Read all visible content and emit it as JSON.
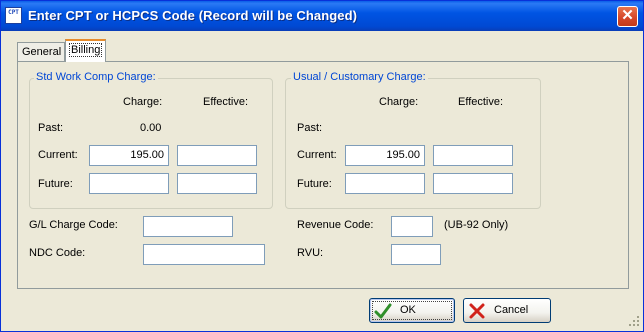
{
  "window": {
    "title": "Enter CPT or HCPCS Code  (Record will be Changed)",
    "icon_text": "CPT"
  },
  "tabs": [
    {
      "label": "General",
      "active": false
    },
    {
      "label": "Billing",
      "active": true
    }
  ],
  "std_group": {
    "title": "Std Work Comp Charge:",
    "col_charge": "Charge:",
    "col_effective": "Effective:",
    "past_label": "Past:",
    "past_value": "0.00",
    "current_label": "Current:",
    "current_charge": "195.00",
    "current_effective": "",
    "future_label": "Future:",
    "future_charge": "",
    "future_effective": ""
  },
  "usual_group": {
    "title": "Usual / Customary Charge:",
    "col_charge": "Charge:",
    "col_effective": "Effective:",
    "past_label": "Past:",
    "current_label": "Current:",
    "current_charge": "195.00",
    "current_effective": "",
    "future_label": "Future:",
    "future_charge": "",
    "future_effective": ""
  },
  "codes": {
    "gl_label": "G/L Charge Code:",
    "gl_value": "",
    "ndc_label": "NDC Code:",
    "ndc_value": "",
    "revenue_label": "Revenue Code:",
    "revenue_value": "",
    "revenue_note": "(UB-92 Only)",
    "rvu_label": "RVU:",
    "rvu_value": ""
  },
  "buttons": {
    "ok": "OK",
    "cancel": "Cancel"
  },
  "colors": {
    "titlebar": "#0054e3",
    "group_title": "#0046d5",
    "dialog_bg": "#ece9d8"
  }
}
